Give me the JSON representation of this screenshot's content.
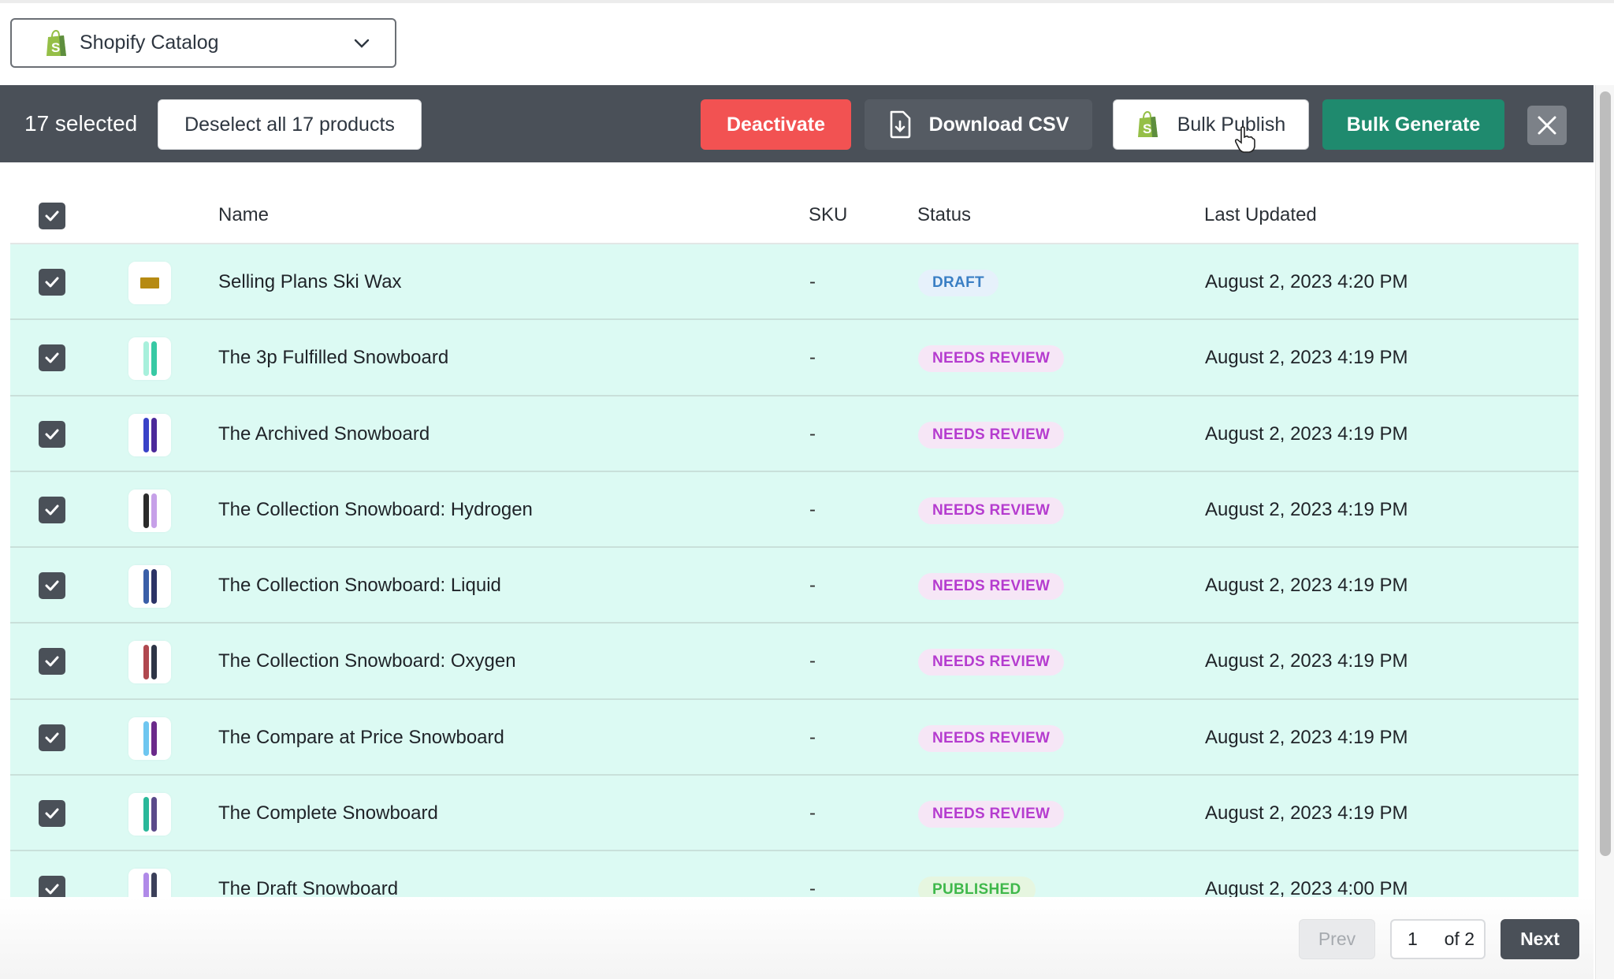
{
  "catalog": {
    "selected": "Shopify Catalog",
    "icon": "shopify-bag-icon"
  },
  "toolbar": {
    "selected_count_label": "17 selected",
    "deselect_label": "Deselect all 17 products",
    "deactivate_label": "Deactivate",
    "download_csv_label": "Download CSV",
    "bulk_publish_label": "Bulk Publish",
    "bulk_generate_label": "Bulk Generate",
    "close_icon": "close-icon",
    "colors": {
      "bar": "#4a5058",
      "deactivate": "#f25252",
      "generate": "#1f8a6e"
    }
  },
  "table": {
    "columns": [
      "Name",
      "SKU",
      "Status",
      "Last Updated"
    ],
    "all_selected": true,
    "rows": [
      {
        "name": "Selling Plans Ski Wax",
        "sku": "-",
        "status": "DRAFT",
        "status_type": "draft",
        "updated": "August 2, 2023 4:20 PM",
        "selected": true,
        "thumb": "wax"
      },
      {
        "name": "The 3p Fulfilled Snowboard",
        "sku": "-",
        "status": "NEEDS REVIEW",
        "status_type": "review",
        "updated": "August 2, 2023 4:19 PM",
        "selected": true,
        "thumb": [
          "#a8f0dc",
          "#37c9a4"
        ]
      },
      {
        "name": "The Archived Snowboard",
        "sku": "-",
        "status": "NEEDS REVIEW",
        "status_type": "review",
        "updated": "August 2, 2023 4:19 PM",
        "selected": true,
        "thumb": [
          "#3943c8",
          "#4b2a9a"
        ]
      },
      {
        "name": "The Collection Snowboard: Hydrogen",
        "sku": "-",
        "status": "NEEDS REVIEW",
        "status_type": "review",
        "updated": "August 2, 2023 4:19 PM",
        "selected": true,
        "thumb": [
          "#2b2b2b",
          "#c6a0e8"
        ]
      },
      {
        "name": "The Collection Snowboard: Liquid",
        "sku": "-",
        "status": "NEEDS REVIEW",
        "status_type": "review",
        "updated": "August 2, 2023 4:19 PM",
        "selected": true,
        "thumb": [
          "#3a5fa8",
          "#2c3366"
        ]
      },
      {
        "name": "The Collection Snowboard: Oxygen",
        "sku": "-",
        "status": "NEEDS REVIEW",
        "status_type": "review",
        "updated": "August 2, 2023 4:19 PM",
        "selected": true,
        "thumb": [
          "#b0484f",
          "#2e3446"
        ]
      },
      {
        "name": "The Compare at Price Snowboard",
        "sku": "-",
        "status": "NEEDS REVIEW",
        "status_type": "review",
        "updated": "August 2, 2023 4:19 PM",
        "selected": true,
        "thumb": [
          "#6ec6f0",
          "#6b2a8a"
        ]
      },
      {
        "name": "The Complete Snowboard",
        "sku": "-",
        "status": "NEEDS REVIEW",
        "status_type": "review",
        "updated": "August 2, 2023 4:19 PM",
        "selected": true,
        "thumb": [
          "#2ab89a",
          "#5a4a8a"
        ]
      },
      {
        "name": "The Draft Snowboard",
        "sku": "-",
        "status": "PUBLISHED",
        "status_type": "published",
        "updated": "August 2, 2023 4:00 PM",
        "selected": true,
        "thumb": [
          "#b08ae8",
          "#3b3f5a"
        ]
      }
    ]
  },
  "pagination": {
    "prev_label": "Prev",
    "current_page": "1",
    "of_label": "of 2",
    "next_label": "Next"
  }
}
